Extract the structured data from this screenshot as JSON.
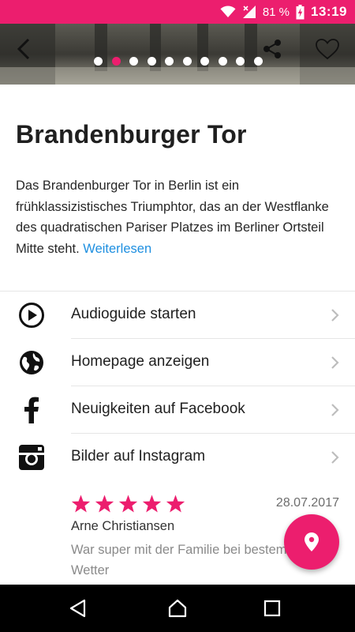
{
  "status_bar": {
    "battery_percent": "81 %",
    "time": "13:19",
    "color": "#ec1e6e"
  },
  "header": {
    "back_icon": "back-arrow-icon",
    "share_icon": "share-icon",
    "favorite_icon": "heart-outline-icon",
    "carousel": {
      "total": 10,
      "active_index": 1
    }
  },
  "place": {
    "title": "Brandenburger Tor",
    "description": "Das Brandenburger Tor in Berlin ist ein frühklassizistisches Triumphtor, das an der Westflanke des quadratischen Pariser Platzes im Berliner Ortsteil Mitte steht.",
    "read_more": "Weiterlesen"
  },
  "menu": {
    "items": [
      {
        "label": "Audioguide starten",
        "icon": "play-circle-icon"
      },
      {
        "label": "Homepage anzeigen",
        "icon": "globe-icon"
      },
      {
        "label": "Neuigkeiten auf Facebook",
        "icon": "facebook-icon"
      },
      {
        "label": "Bilder auf Instagram",
        "icon": "instagram-icon"
      }
    ]
  },
  "review": {
    "rating": 5,
    "max_rating": 5,
    "date": "28.07.2017",
    "author": "Arne Christiansen",
    "text": "War super mit der Familie bei bestem Wetter"
  },
  "fab": {
    "icon": "location-pin-icon"
  },
  "nav_bar": {
    "back_icon": "nav-back-icon",
    "home_icon": "nav-home-icon",
    "recents_icon": "nav-recents-icon"
  },
  "colors": {
    "accent": "#ec1e6e",
    "link": "#1e8fe0"
  }
}
